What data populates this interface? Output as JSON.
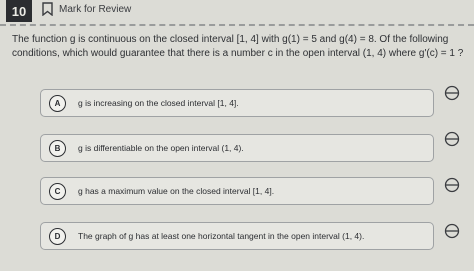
{
  "header": {
    "question_number": "10",
    "mark_for_review": "Mark for Review"
  },
  "question": {
    "stem_line1": "The function g is continuous on the closed interval [1, 4] with g(1) = 5 and g(4) = 8. Of the following",
    "stem_line2": "conditions, which would guarantee that there is a number c in the open interval (1, 4) where g'(c) = 1 ?"
  },
  "choices": [
    {
      "letter": "A",
      "text": "g is increasing on the closed interval [1, 4]."
    },
    {
      "letter": "B",
      "text": "g is differentiable on the open interval (1, 4)."
    },
    {
      "letter": "C",
      "text": "g has a maximum value on the closed interval [1, 4]."
    },
    {
      "letter": "D",
      "text": "The graph of g has at least one horizontal tangent in the open interval (1, 4)."
    }
  ],
  "icons": {
    "bookmark": "bookmark-icon",
    "eliminate": "eliminate-choice-icon"
  }
}
